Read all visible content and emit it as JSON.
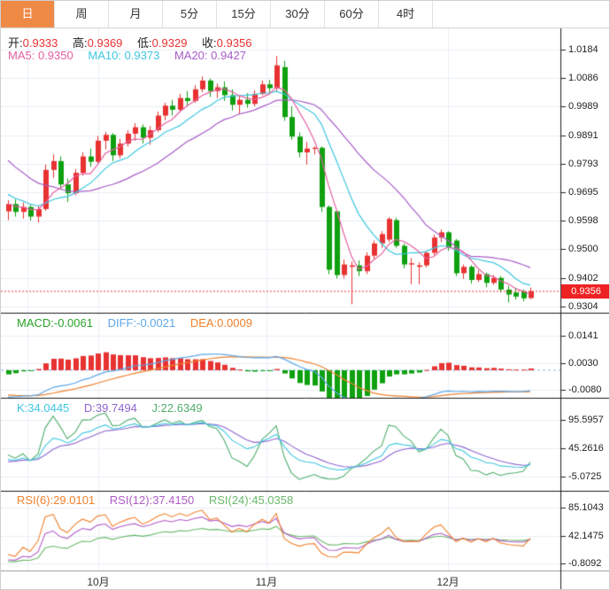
{
  "toolbar": {
    "tabs": [
      {
        "label": "日",
        "active": true
      },
      {
        "label": "周",
        "active": false
      },
      {
        "label": "月",
        "active": false
      },
      {
        "label": "5分",
        "active": false
      },
      {
        "label": "15分",
        "active": false
      },
      {
        "label": "30分",
        "active": false
      },
      {
        "label": "60分",
        "active": false
      },
      {
        "label": "4时",
        "active": false
      }
    ]
  },
  "ohlc_legend": {
    "open_label": "开:",
    "open": "0.9333",
    "high_label": "高:",
    "high": "0.9369",
    "low_label": "低:",
    "low": "0.9329",
    "close_label": "收:",
    "close": "0.9356"
  },
  "ma_legend": {
    "ma5_label": "MA5:",
    "ma5": "0.9350",
    "ma10_label": "MA10:",
    "ma10": "0.9373",
    "ma20_label": "MA20:",
    "ma20": "0.9427"
  },
  "macd_legend": {
    "macd_label": "MACD:",
    "macd": "-0.0061",
    "diff_label": "DIFF:",
    "diff": "-0.0021",
    "dea_label": "DEA:",
    "dea": "0.0009"
  },
  "kdj_legend": {
    "k_label": "K:",
    "k": "34.0445",
    "d_label": "D:",
    "d": "39.7494",
    "j_label": "J:",
    "j": "22.6349"
  },
  "rsi_legend": {
    "rsi6_label": "RSI(6):",
    "rsi6": "29.0101",
    "rsi12_label": "RSI(12):",
    "rsi12": "37.4150",
    "rsi24_label": "RSI(24):",
    "rsi24": "45.0358"
  },
  "price_badge": "0.9356",
  "axes": {
    "main": [
      "1.0184",
      "1.0086",
      "0.9989",
      "0.9891",
      "0.9793",
      "0.9695",
      "0.9598",
      "0.9500",
      "0.9402",
      "0.9304"
    ],
    "macd": [
      "0.0141",
      "0.0030",
      "-0.0080"
    ],
    "kdj": [
      "95.5957",
      "45.2616",
      "-5.0725"
    ],
    "rsi": [
      "85.1043",
      "42.1475",
      "-0.8092"
    ],
    "months": [
      "10月",
      "11月",
      "12月"
    ]
  },
  "colors": {
    "accent_orange": "#ef8a46",
    "candle_up": "#e83232",
    "candle_down": "#0fa00f",
    "ma5": "#e560a2",
    "ma10": "#3ec6e0",
    "ma20": "#a85cc8",
    "macd_text": "#28a428",
    "diff": "#5ea8e8",
    "dea": "#f0812d",
    "d": "#8f66d0",
    "j": "#4fae6d",
    "rsi12": "#b05cc6",
    "rsi24": "#6ab96a",
    "grid": "#e9eef5",
    "axis_text": "#222222",
    "badge_bg": "#ee2222",
    "price_line": "#e83232"
  },
  "chart_data": {
    "type": "candlestick",
    "note": "daily bars, values as [open, high, low, close]; price axis 0.9304-1.0184; sub-panels MACD, KDJ, RSI",
    "panels": [
      "MACD",
      "KDJ",
      "RSI"
    ],
    "last_close": 0.9356,
    "ohlc": [
      [
        0.963,
        0.9668,
        0.96,
        0.9655
      ],
      [
        0.9655,
        0.9672,
        0.9612,
        0.9628
      ],
      [
        0.9628,
        0.966,
        0.9605,
        0.9645
      ],
      [
        0.9645,
        0.9652,
        0.9598,
        0.9612
      ],
      [
        0.9612,
        0.9648,
        0.9592,
        0.9638
      ],
      [
        0.9638,
        0.979,
        0.9632,
        0.9772
      ],
      [
        0.9772,
        0.9825,
        0.9745,
        0.9802
      ],
      [
        0.9802,
        0.9818,
        0.9705,
        0.9722
      ],
      [
        0.9722,
        0.9742,
        0.9662,
        0.9692
      ],
      [
        0.9692,
        0.9775,
        0.9685,
        0.9762
      ],
      [
        0.9762,
        0.9832,
        0.9752,
        0.9818
      ],
      [
        0.9818,
        0.9845,
        0.9782,
        0.98
      ],
      [
        0.98,
        0.9888,
        0.9795,
        0.9872
      ],
      [
        0.9872,
        0.9902,
        0.9842,
        0.9892
      ],
      [
        0.9892,
        0.9898,
        0.9802,
        0.9822
      ],
      [
        0.9822,
        0.9878,
        0.9812,
        0.9862
      ],
      [
        0.9862,
        0.9908,
        0.9852,
        0.9896
      ],
      [
        0.9896,
        0.9932,
        0.9872,
        0.9918
      ],
      [
        0.9918,
        0.9928,
        0.9862,
        0.9882
      ],
      [
        0.9882,
        0.9922,
        0.9858,
        0.9908
      ],
      [
        0.9908,
        0.9972,
        0.9902,
        0.9958
      ],
      [
        0.9958,
        1.0002,
        0.9942,
        0.9992
      ],
      [
        0.9992,
        1.0012,
        0.9958,
        0.9978
      ],
      [
        0.9978,
        1.0032,
        0.9972,
        1.0018
      ],
      [
        1.0018,
        1.0042,
        0.9992,
        1.0008
      ],
      [
        1.0008,
        1.0062,
        1.0002,
        1.0048
      ],
      [
        1.0048,
        1.0092,
        1.0038,
        1.0078
      ],
      [
        1.0078,
        1.0085,
        1.0022,
        1.0042
      ],
      [
        1.0042,
        1.0068,
        1.0018,
        1.0055
      ],
      [
        1.0055,
        1.0075,
        1.0008,
        1.0028
      ],
      [
        1.0028,
        1.0048,
        0.9975,
        0.9995
      ],
      [
        0.9995,
        1.0025,
        0.9962,
        1.0012
      ],
      [
        1.0012,
        1.0035,
        0.9985,
        0.9998
      ],
      [
        0.9998,
        1.0045,
        0.999,
        1.0032
      ],
      [
        1.0032,
        1.0078,
        1.0028,
        1.0065
      ],
      [
        1.0065,
        1.008,
        1.0035,
        1.0052
      ],
      [
        1.0052,
        1.0162,
        1.004,
        1.013
      ],
      [
        1.0124,
        1.0145,
        0.994,
        0.9953
      ],
      [
        0.9953,
        0.999,
        0.9875,
        0.9886
      ],
      [
        0.9886,
        0.99,
        0.9815,
        0.9832
      ],
      [
        0.9832,
        0.9868,
        0.979,
        0.9845
      ],
      [
        0.9845,
        0.9852,
        0.9825,
        0.9848
      ],
      [
        0.9848,
        0.9852,
        0.9628,
        0.9645
      ],
      [
        0.9645,
        0.965,
        0.9415,
        0.943
      ],
      [
        0.963,
        0.9635,
        0.94,
        0.9412
      ],
      [
        0.9412,
        0.9465,
        0.94,
        0.9448
      ],
      [
        0.944,
        0.9458,
        0.9312,
        0.9445
      ],
      [
        0.9445,
        0.9462,
        0.9408,
        0.9425
      ],
      [
        0.9425,
        0.949,
        0.9415,
        0.9478
      ],
      [
        0.9478,
        0.953,
        0.9468,
        0.952
      ],
      [
        0.952,
        0.9562,
        0.9505,
        0.9552
      ],
      [
        0.9533,
        0.961,
        0.9525,
        0.9604
      ],
      [
        0.96,
        0.9608,
        0.9505,
        0.9512
      ],
      [
        0.9512,
        0.952,
        0.9435,
        0.9448
      ],
      [
        0.9448,
        0.947,
        0.938,
        0.9452
      ],
      [
        0.944,
        0.9455,
        0.938,
        0.9445
      ],
      [
        0.9445,
        0.9495,
        0.9438,
        0.9488
      ],
      [
        0.9488,
        0.955,
        0.948,
        0.954
      ],
      [
        0.954,
        0.9568,
        0.9525,
        0.9558
      ],
      [
        0.9558,
        0.9562,
        0.9495,
        0.9505
      ],
      [
        0.953,
        0.9535,
        0.9408,
        0.9418
      ],
      [
        0.9418,
        0.9448,
        0.9398,
        0.944
      ],
      [
        0.944,
        0.9446,
        0.9382,
        0.9395
      ],
      [
        0.9395,
        0.9428,
        0.9388,
        0.9415
      ],
      [
        0.9415,
        0.942,
        0.937,
        0.9385
      ],
      [
        0.9385,
        0.9412,
        0.9378,
        0.9402
      ],
      [
        0.9402,
        0.9408,
        0.9352,
        0.9362
      ],
      [
        0.9362,
        0.9375,
        0.9318,
        0.9345
      ],
      [
        0.9352,
        0.9368,
        0.9328,
        0.9338
      ],
      [
        0.9355,
        0.9362,
        0.9322,
        0.9332
      ],
      [
        0.9333,
        0.9369,
        0.9329,
        0.9356
      ]
    ]
  }
}
